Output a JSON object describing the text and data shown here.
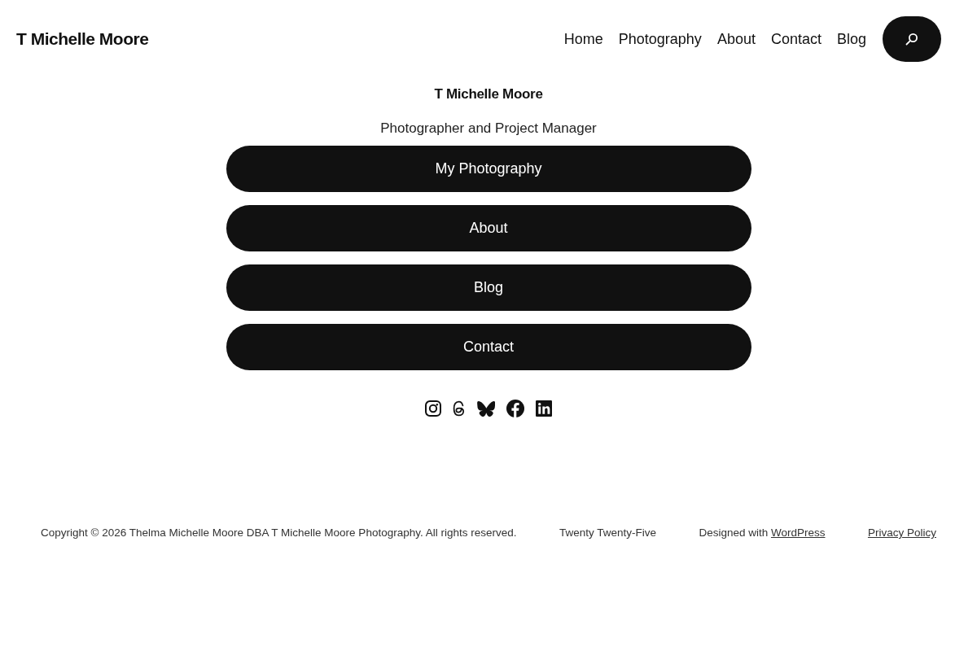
{
  "header": {
    "site_title": "T Michelle Moore",
    "nav": [
      {
        "label": "Home"
      },
      {
        "label": "Photography"
      },
      {
        "label": "About"
      },
      {
        "label": "Contact"
      },
      {
        "label": "Blog"
      }
    ]
  },
  "intro": {
    "title": "T Michelle Moore",
    "tagline": "Photographer and Project Manager"
  },
  "buttons": [
    "My Photography",
    "About",
    "Blog",
    "Contact"
  ],
  "footer": {
    "copyright": "Copyright © 2026 Thelma Michelle Moore DBA T Michelle Moore Photography. All rights reserved.",
    "theme": "Twenty Twenty-Five",
    "credit": {
      "text": "Designed with",
      "link": "WordPress"
    },
    "privacy_link": "Privacy Policy"
  }
}
